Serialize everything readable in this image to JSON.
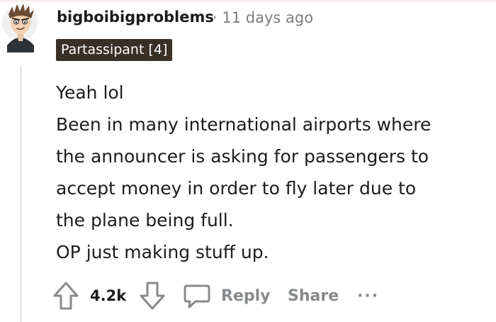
{
  "comment": {
    "username": "bigboibigproblems",
    "separator": "·",
    "time_ago": "11 days ago",
    "flair": "Partassipant [4]",
    "body_lines": [
      "Yeah lol",
      "Been in many international airports where",
      "the announcer is asking for passengers to",
      "accept money in order to fly later due to",
      "the plane being full.",
      "OP just making stuff up."
    ]
  },
  "actions": {
    "upvote_icon": "arrow-up-icon",
    "score": "4.2k",
    "downvote_icon": "arrow-down-icon",
    "reply_icon": "speech-bubble-icon",
    "reply_label": "Reply",
    "share_label": "Share",
    "more_label": "···",
    "more_icon": "ellipsis-icon"
  },
  "colors": {
    "flair_background": "#3a2f25",
    "flair_text": "#ffffff",
    "muted_text": "#878a8c",
    "thread_line": "#e9e9e9"
  }
}
